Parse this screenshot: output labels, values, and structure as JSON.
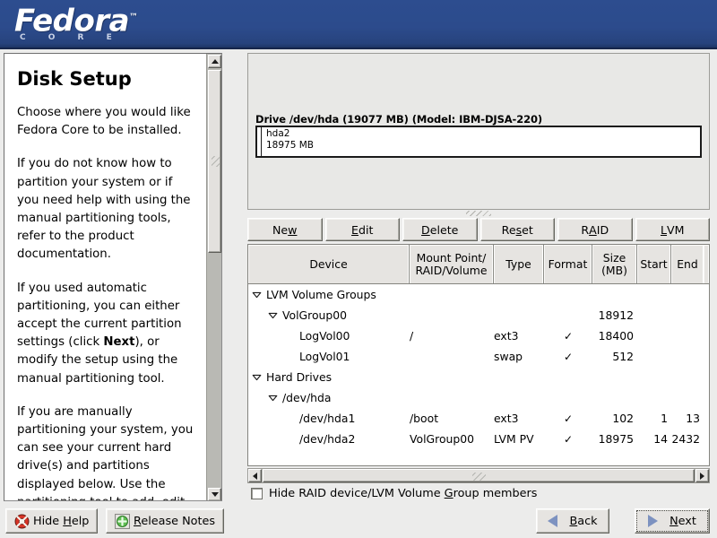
{
  "banner": {
    "logo": "Fedora",
    "trademark": "™",
    "subtitle": "C O R E"
  },
  "help": {
    "title": "Disk Setup",
    "paragraphs": [
      "Choose where you would like Fedora Core to be installed.",
      "If you do not know how to partition your system or if you need help with using the manual partitioning tools, refer to the product documentation.",
      "If you used automatic partitioning, you can either accept the current partition settings (click ",
      "), or modify the setup using the manual partitioning tool.",
      "If you are manually partitioning your system, you can see your current hard drive(s) and partitions displayed below. Use the partitioning tool to add, edit,"
    ],
    "bold_inline": "Next",
    "scrollbar": {
      "up_icon": "triangle-up-icon",
      "down_icon": "triangle-down-icon"
    }
  },
  "drive": {
    "label": "Drive /dev/hda (19077 MB) (Model: IBM-DJSA-220)",
    "partition_name": "hda2",
    "partition_size": "18975 MB"
  },
  "toolbar": {
    "buttons": [
      {
        "pre": "Ne",
        "mnemonic": "w",
        "post": ""
      },
      {
        "pre": "",
        "mnemonic": "E",
        "post": "dit"
      },
      {
        "pre": "",
        "mnemonic": "D",
        "post": "elete"
      },
      {
        "pre": "Re",
        "mnemonic": "s",
        "post": "et"
      },
      {
        "pre": "R",
        "mnemonic": "A",
        "post": "ID"
      },
      {
        "pre": "",
        "mnemonic": "L",
        "post": "VM"
      }
    ]
  },
  "table": {
    "headers": {
      "device": "Device",
      "mount_line1": "Mount Point/",
      "mount_line2": "RAID/Volume",
      "type": "Type",
      "format": "Format",
      "size_line1": "Size",
      "size_line2": "(MB)",
      "start": "Start",
      "end": "End"
    },
    "rows": [
      {
        "indent": 0,
        "expander": true,
        "device": "LVM Volume Groups",
        "mount": "",
        "type": "",
        "format": "",
        "size": "",
        "start": "",
        "end": ""
      },
      {
        "indent": 1,
        "expander": true,
        "device": "VolGroup00",
        "mount": "",
        "type": "",
        "format": "",
        "size": "18912",
        "start": "",
        "end": ""
      },
      {
        "indent": 2,
        "expander": false,
        "device": "LogVol00",
        "mount": "/",
        "type": "ext3",
        "format": "✓",
        "size": "18400",
        "start": "",
        "end": ""
      },
      {
        "indent": 2,
        "expander": false,
        "device": "LogVol01",
        "mount": "",
        "type": "swap",
        "format": "✓",
        "size": "512",
        "start": "",
        "end": ""
      },
      {
        "indent": 0,
        "expander": true,
        "device": "Hard Drives",
        "mount": "",
        "type": "",
        "format": "",
        "size": "",
        "start": "",
        "end": ""
      },
      {
        "indent": 1,
        "expander": true,
        "device": "/dev/hda",
        "mount": "",
        "type": "",
        "format": "",
        "size": "",
        "start": "",
        "end": ""
      },
      {
        "indent": 2,
        "expander": false,
        "device": "/dev/hda1",
        "mount": "/boot",
        "type": "ext3",
        "format": "✓",
        "size": "102",
        "start": "1",
        "end": "13"
      },
      {
        "indent": 2,
        "expander": false,
        "device": "/dev/hda2",
        "mount": "VolGroup00",
        "type": "LVM PV",
        "format": "✓",
        "size": "18975",
        "start": "14",
        "end": "2432"
      }
    ]
  },
  "hide_members": {
    "checked": false,
    "label_pre": "Hide RAID device/LVM Volume ",
    "label_mnemonic": "G",
    "label_post": "roup members"
  },
  "bottom": {
    "hide_help": {
      "pre": "Hide ",
      "mnemonic": "H",
      "post": "elp",
      "icon": "lifebuoy-icon"
    },
    "release_notes": {
      "pre": "",
      "mnemonic": "R",
      "post": "elease Notes",
      "icon": "green-plus-icon"
    },
    "back": {
      "pre": "",
      "mnemonic": "B",
      "post": "ack",
      "icon": "arrow-left-icon"
    },
    "next": {
      "pre": "",
      "mnemonic": "N",
      "post": "ext",
      "icon": "arrow-right-icon"
    }
  },
  "colors": {
    "banner_blue": "#2c4b8c",
    "face": "#e6e4e1",
    "window_bg": "#ececeb",
    "nav_arrow": "#7d92c0",
    "text": "#000000"
  }
}
